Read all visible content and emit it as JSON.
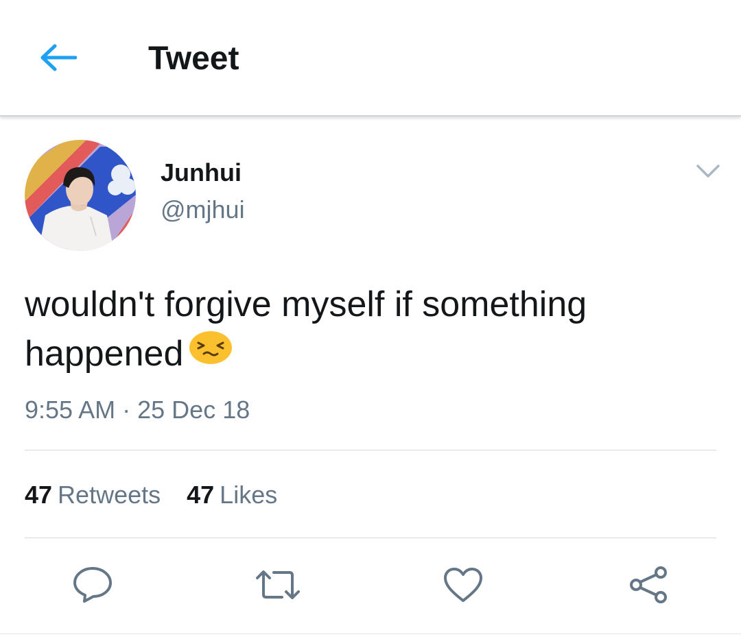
{
  "header": {
    "title": "Tweet",
    "back_icon": "arrow-left-icon",
    "accent_color": "#1da1f2"
  },
  "tweet": {
    "author": {
      "name": "Junhui",
      "handle": "@mjhui"
    },
    "text_line1": "wouldn't forgive myself if something",
    "text_line2": "happened",
    "emoji": "worried-face-emoji",
    "time": "9:55 AM",
    "separator": "·",
    "date": "25 Dec 18",
    "retweets": {
      "count": "47",
      "label": "Retweets"
    },
    "likes": {
      "count": "47",
      "label": "Likes"
    }
  },
  "actions": {
    "reply_icon": "reply-bubble-icon",
    "retweet_icon": "retweet-icon",
    "like_icon": "heart-icon",
    "share_icon": "share-icon"
  },
  "colors": {
    "text_primary": "#14171a",
    "text_secondary": "#657786",
    "icon_gray": "#657786",
    "emoji_yellow": "#fbc02d"
  }
}
